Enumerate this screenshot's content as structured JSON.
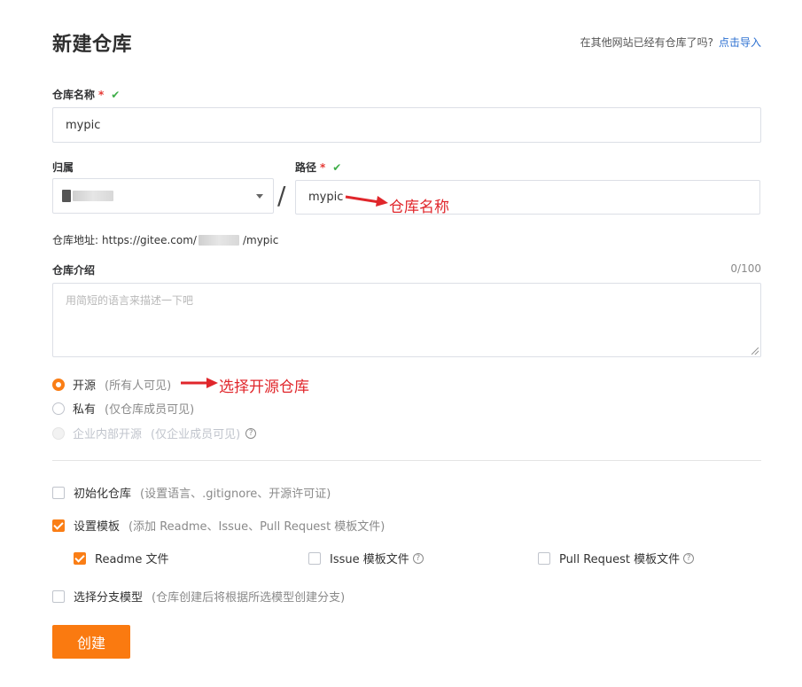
{
  "page": {
    "title": "新建仓库",
    "import_prompt": "在其他网站已经有仓库了吗?",
    "import_link": "点击导入"
  },
  "repo_name": {
    "label": "仓库名称",
    "required_mark": "*",
    "valid_mark": "✔",
    "value": "mypic"
  },
  "owner": {
    "label": "归属"
  },
  "path": {
    "label": "路径",
    "required_mark": "*",
    "valid_mark": "✔",
    "separator": "/",
    "value": "mypic"
  },
  "repo_address": {
    "label": "仓库地址:",
    "prefix": "https://gitee.com/",
    "suffix": "/mypic"
  },
  "description": {
    "label": "仓库介绍",
    "counter": "0/100",
    "placeholder": "用简短的语言来描述一下吧"
  },
  "visibility": {
    "options": [
      {
        "label": "开源",
        "hint": "(所有人可见)",
        "selected": true,
        "disabled": false
      },
      {
        "label": "私有",
        "hint": "(仅仓库成员可见)",
        "selected": false,
        "disabled": false
      },
      {
        "label": "企业内部开源",
        "hint": "(仅企业成员可见)",
        "selected": false,
        "disabled": true
      }
    ],
    "help_icon": "?"
  },
  "init_repo": {
    "label": "初始化仓库",
    "hint": "(设置语言、.gitignore、开源许可证)",
    "checked": false
  },
  "template": {
    "label": "设置模板",
    "hint": "(添加 Readme、Issue、Pull Request 模板文件)",
    "checked": true,
    "options": [
      {
        "label": "Readme 文件",
        "checked": true
      },
      {
        "label": "Issue 模板文件",
        "checked": false
      },
      {
        "label": "Pull Request 模板文件",
        "checked": false
      }
    ],
    "help_icon": "?"
  },
  "branch_model": {
    "label": "选择分支模型",
    "hint": "(仓库创建后将根据所选模型创建分支)",
    "checked": false
  },
  "create_button": "创建",
  "annotations": {
    "repo_name_note": "仓库名称",
    "open_source_note": "选择开源仓库",
    "color": "#e0262b"
  },
  "colors": {
    "accent": "#fa7a10",
    "link": "#2b6fd1",
    "valid": "#3fae49",
    "required": "#e53935"
  }
}
